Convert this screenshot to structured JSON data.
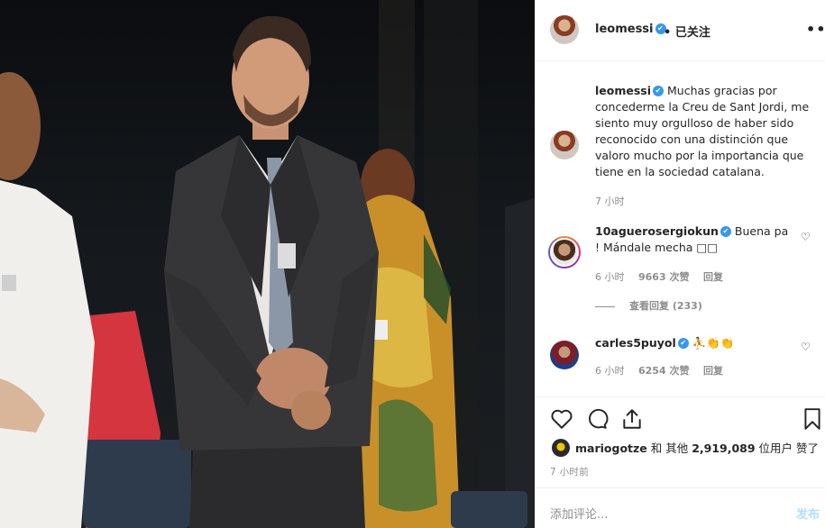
{
  "post": {
    "author": "leomessi",
    "follow_status": "• 已关注",
    "more_label": "•••"
  },
  "caption": {
    "author": "leomessi",
    "text": "Muchas gracias por concederme la Creu de Sant Jordi, me siento muy orgulloso de haber sido reconocido con una distinción que valoro mucho por la importancia que tiene en la sociedad catalana.",
    "time": "7 小时"
  },
  "comments": [
    {
      "author": "10aguerosergiokun",
      "text": "Buena pa ! Mándale mecha □□",
      "time": "6 小时",
      "likes": "9663 次赞",
      "reply": "回复",
      "view_replies": "查看回复 (233)"
    },
    {
      "author": "carles5puyol",
      "text": "⛹👏👏",
      "time": "6 小时",
      "likes": "6254 次赞",
      "reply": "回复"
    }
  ],
  "likes_bar": {
    "user": "mariogotze",
    "joiner": " 和 其他 ",
    "count": "2,919,089",
    "suffix": " 位用户 赞了"
  },
  "post_time": "7 小时前",
  "add_comment_placeholder": "添加评论...",
  "post_button": "发布",
  "icons": {
    "verified": "✔"
  },
  "colors": {
    "verified_blue": "#3897f0",
    "muted": "#8e8e8e",
    "post_button_disabled": "#b2dffc"
  }
}
